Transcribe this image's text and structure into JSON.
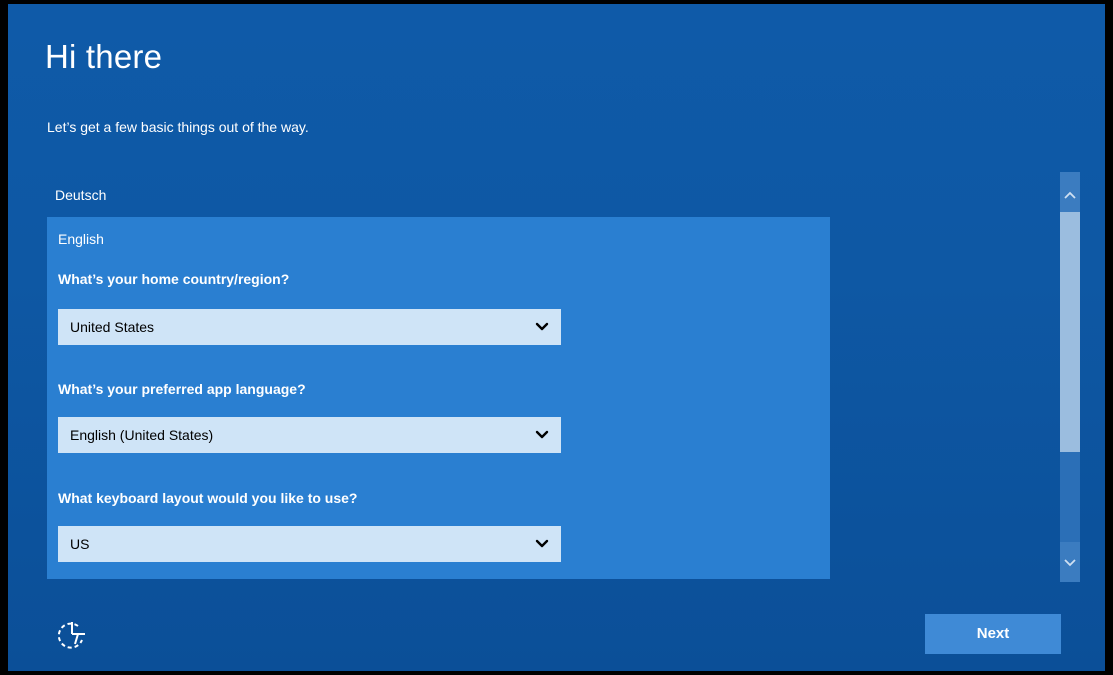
{
  "header": {
    "title": "Hi there",
    "subtitle": "Let’s get a few basic things out of the way."
  },
  "languages": {
    "items": [
      "Deutsch",
      "English"
    ],
    "selected": "English"
  },
  "form": {
    "country": {
      "question": "What’s your home country/region?",
      "value": "United States"
    },
    "app_language": {
      "question": "What’s your preferred app language?",
      "value": "English (United States)"
    },
    "keyboard": {
      "question": "What keyboard layout would you like to use?",
      "value": "US"
    }
  },
  "footer": {
    "accessibility_icon": "ease-of-access-icon",
    "next_label": "Next"
  },
  "colors": {
    "background": "#0f5aa8",
    "selected_panel": "#2a7fd1",
    "select_field": "#cfe4f7",
    "next_button": "#3f8ad6",
    "scroll_thumb": "#9bbddf"
  }
}
